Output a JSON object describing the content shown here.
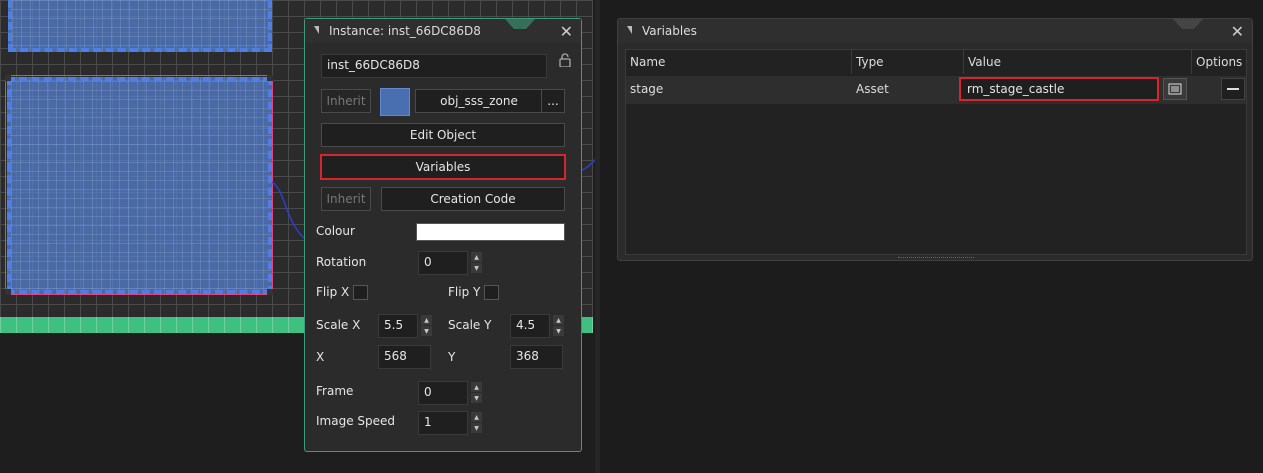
{
  "instance_window": {
    "title": "Instance: inst_66DC86D8",
    "instance_name": "inst_66DC86D8",
    "inherit_label": "Inherit",
    "object_name": "obj_sss_zone",
    "object_menu_label": "...",
    "edit_object_label": "Edit Object",
    "variables_label": "Variables",
    "inherit_code_label": "Inherit",
    "creation_code_label": "Creation Code",
    "colour_label": "Colour",
    "colour_value": "#ffffff",
    "rotation_label": "Rotation",
    "rotation_value": "0",
    "flip_x_label": "Flip X",
    "flip_y_label": "Flip Y",
    "scale_x_label": "Scale X",
    "scale_x_value": "5.5",
    "scale_y_label": "Scale Y",
    "scale_y_value": "4.5",
    "x_label": "X",
    "x_value": "568",
    "y_label": "Y",
    "y_value": "368",
    "frame_label": "Frame",
    "frame_value": "0",
    "image_speed_label": "Image Speed",
    "image_speed_value": "1"
  },
  "variables_window": {
    "title": "Variables",
    "columns": [
      "Name",
      "Type",
      "Value",
      "Options"
    ],
    "rows": [
      {
        "name": "stage",
        "type": "Asset",
        "value": "rm_stage_castle"
      }
    ]
  },
  "colors": {
    "highlight": "#d8252b",
    "window_border_active": "#3e9b79",
    "zone_fill": "#5680d0",
    "ground": "#3fbf80"
  }
}
